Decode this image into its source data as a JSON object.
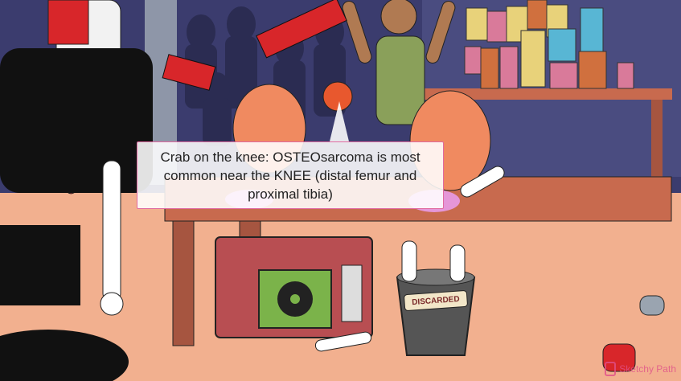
{
  "tooltip": {
    "text": "Crab on the knee: OSTEOsarcoma is most common near the KNEE (distal femur and proximal tibia)"
  },
  "scene": {
    "bin_label": "DISCARDED",
    "watermark": "Sketchy Path"
  },
  "colors": {
    "floor": "#f2b08f",
    "wall": "#3b3c6e",
    "table": "#c86a4e",
    "microwave": "#b84e52",
    "screen": "#7bb34a",
    "tooltip_border": "#e06aa0"
  }
}
